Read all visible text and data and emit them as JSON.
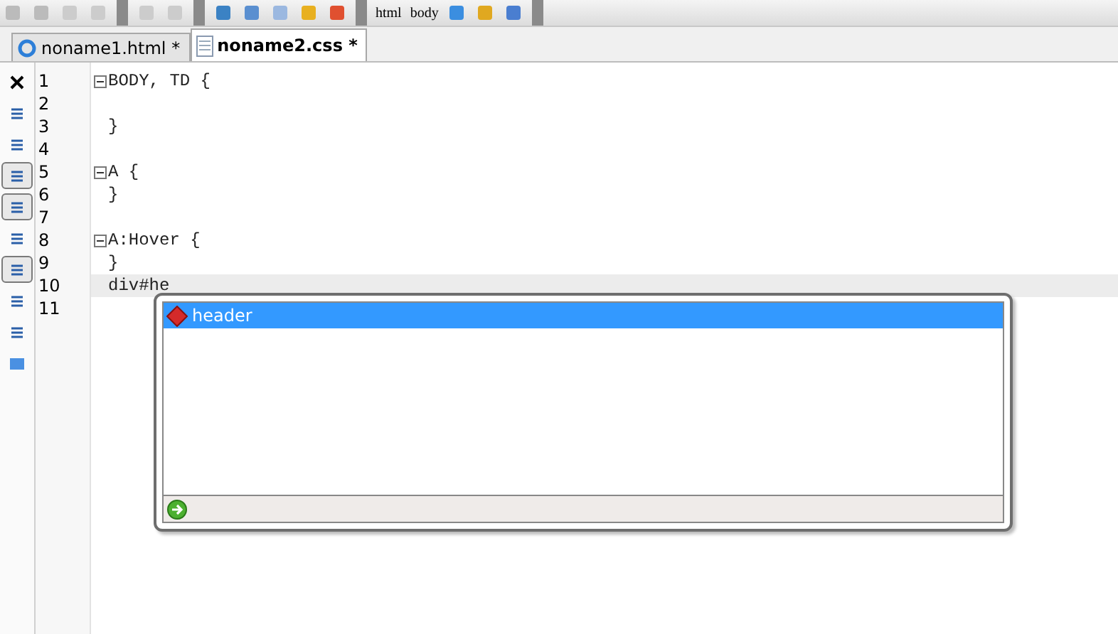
{
  "toolbar": {
    "labels": [
      "html",
      "body"
    ]
  },
  "tabs": [
    {
      "label": "noname1.html *",
      "kind": "html",
      "selected": false
    },
    {
      "label": "noname2.css *",
      "kind": "css",
      "selected": true
    }
  ],
  "side_tools": [
    {
      "pressed": false
    },
    {
      "pressed": false
    },
    {
      "pressed": false
    },
    {
      "pressed": true
    },
    {
      "pressed": true
    },
    {
      "pressed": false
    },
    {
      "pressed": true
    },
    {
      "pressed": false
    },
    {
      "pressed": false
    },
    {
      "pressed": false
    }
  ],
  "lines": [
    {
      "number": "1",
      "text": "BODY, TD {",
      "fold": true,
      "current": false
    },
    {
      "number": "2",
      "fold": false,
      "current": false
    },
    {
      "number": "3",
      "text": "}",
      "fold": false,
      "current": false
    },
    {
      "number": "4",
      "fold": false,
      "current": false
    },
    {
      "number": "5",
      "text": "A {",
      "fold": true,
      "current": false
    },
    {
      "number": "6",
      "text": "}",
      "fold": false,
      "current": false
    },
    {
      "number": "7",
      "fold": false,
      "current": false
    },
    {
      "number": "8",
      "text": "A:Hover {",
      "fold": true,
      "current": false
    },
    {
      "number": "9",
      "text": "}",
      "fold": false,
      "current": false
    },
    {
      "number": "10",
      "text": "div#he",
      "fold": false,
      "current": true
    },
    {
      "number": "11",
      "fold": false,
      "current": false
    }
  ],
  "completion": {
    "items": [
      {
        "label": "header",
        "selected": true
      }
    ]
  }
}
